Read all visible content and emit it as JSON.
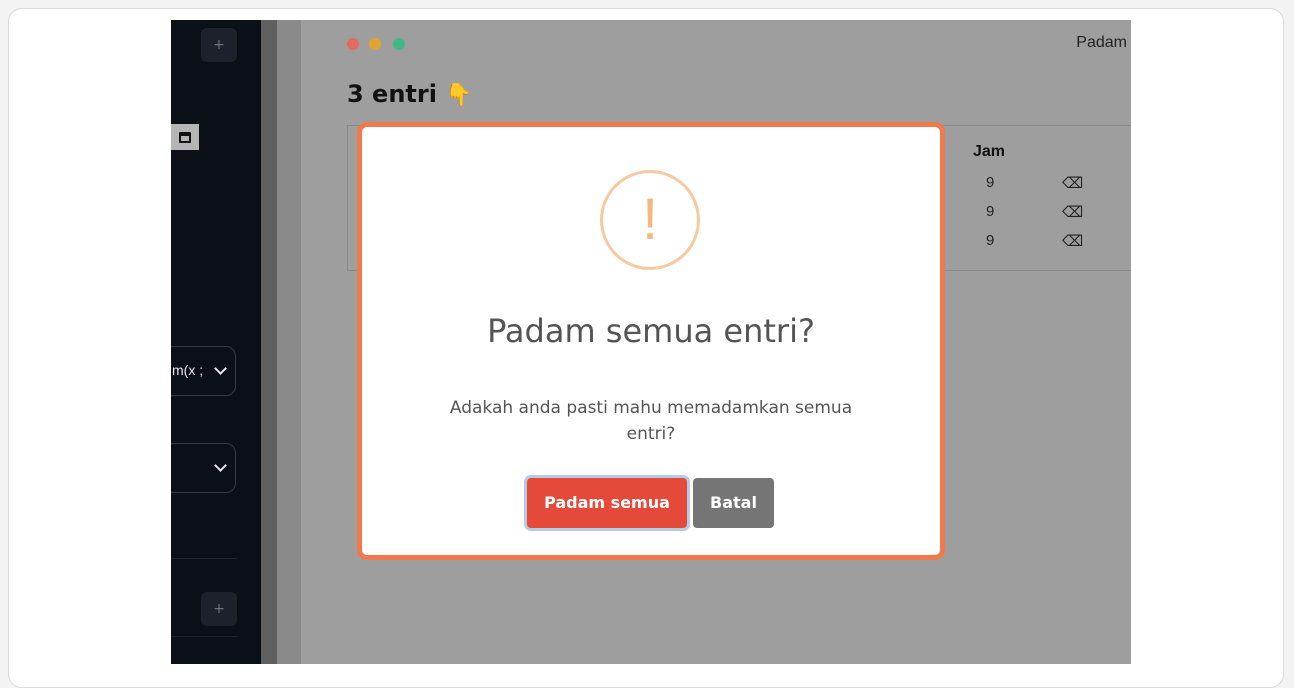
{
  "sidebar": {
    "top_button_label": "+",
    "bottom_button_label": "+",
    "calendar_icon": "calendar-icon",
    "select1_value": "m(x ;",
    "select2_value": ""
  },
  "window": {
    "controls": [
      "#e26a5e",
      "#e0a52f",
      "#3fb98a"
    ],
    "header_right": "Padam"
  },
  "main": {
    "entries_title": "3 entri",
    "entries_emoji": "👇",
    "table": {
      "column_header": "Jam",
      "rows": [
        {
          "jam": "9",
          "delete_icon": "⌫"
        },
        {
          "jam": "9",
          "delete_icon": "⌫"
        },
        {
          "jam": "9",
          "delete_icon": "⌫"
        }
      ]
    }
  },
  "modal": {
    "icon": "warning-icon",
    "icon_glyph": "!",
    "title": "Padam semua entri?",
    "message": "Adakah anda pasti mahu memadamkan semua entri?",
    "confirm_label": "Padam semua",
    "cancel_label": "Batal",
    "colors": {
      "accent": "#e5493a",
      "border": "#f07a4e",
      "cancel": "#757575",
      "icon": "#f8c9a0"
    }
  }
}
